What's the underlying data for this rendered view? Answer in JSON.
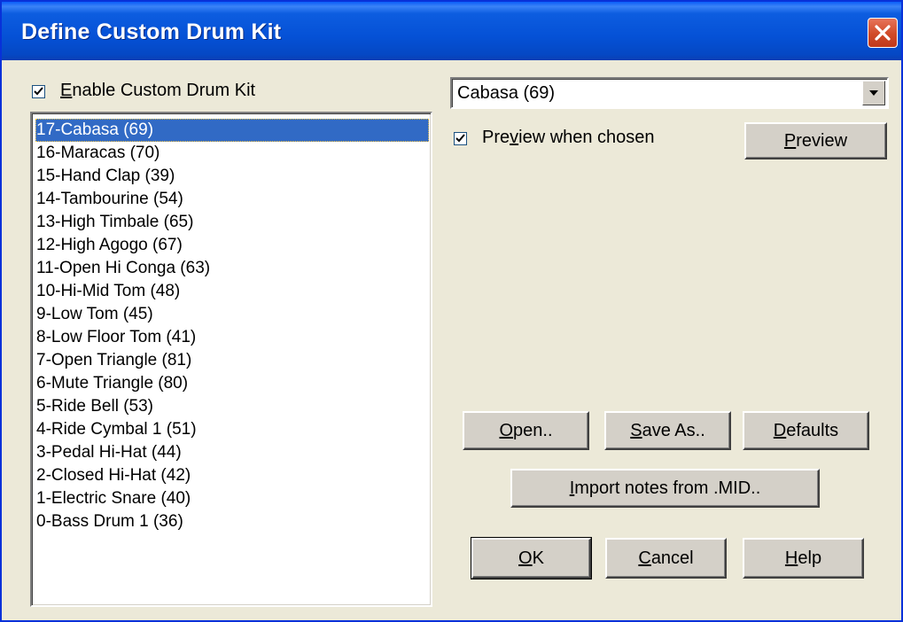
{
  "window": {
    "title": "Define Custom Drum Kit"
  },
  "enable": {
    "label_pre": "",
    "label_key": "E",
    "label_post": "nable Custom Drum Kit",
    "checked": true
  },
  "drum_list": {
    "selected_index": 0,
    "items": [
      "17-Cabasa (69)",
      "16-Maracas (70)",
      "15-Hand Clap (39)",
      "14-Tambourine (54)",
      "13-High Timbale (65)",
      "12-High Agogo (67)",
      "11-Open Hi Conga (63)",
      "10-Hi-Mid Tom (48)",
      "9-Low Tom  (45)",
      "8-Low Floor Tom (41)",
      "7-Open Triangle (81)",
      "6-Mute Triangle (80)",
      "5-Ride Bell (53)",
      "4-Ride Cymbal 1 (51)",
      "3-Pedal Hi-Hat (44)",
      "2-Closed Hi-Hat (42)",
      "1-Electric Snare (40)",
      "0-Bass Drum 1 (36)"
    ]
  },
  "instrument_combo": {
    "value": "Cabasa (69)"
  },
  "preview_checkbox": {
    "label_pre": "Pre",
    "label_key": "v",
    "label_post": "iew when chosen",
    "checked": true
  },
  "buttons": {
    "preview": {
      "pre": "",
      "key": "P",
      "post": "review"
    },
    "open": {
      "pre": "",
      "key": "O",
      "post": "pen.."
    },
    "save_as": {
      "pre": "",
      "key": "S",
      "post": "ave As.."
    },
    "defaults": {
      "pre": "",
      "key": "D",
      "post": "efaults"
    },
    "import": {
      "pre": "",
      "key": "I",
      "post": "mport notes from .MID.."
    },
    "ok": {
      "pre": "",
      "key": "O",
      "post": "K"
    },
    "cancel": {
      "pre": "",
      "key": "C",
      "post": "ancel"
    },
    "help": {
      "pre": "",
      "key": "H",
      "post": "elp"
    }
  },
  "colors": {
    "titlebar": "#0551d6",
    "selection": "#316ac5",
    "dialog_bg": "#ece9d8",
    "close": "#d04a28"
  }
}
